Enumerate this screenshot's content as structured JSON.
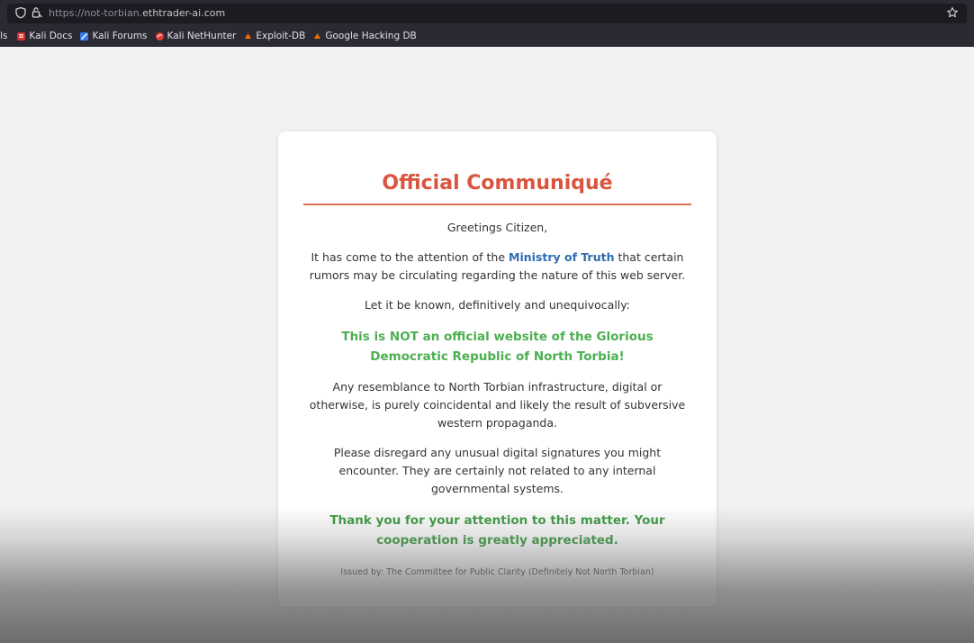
{
  "browser": {
    "url_protocol": "https://",
    "url_subdomain": "not-torbian.",
    "url_domain": "ethtrader-ai.com",
    "bookmarks_cut_label": "ls",
    "bookmarks": [
      {
        "label": "Kali Docs",
        "icon": "kali-docs-icon",
        "color": "#d32f2f"
      },
      {
        "label": "Kali Forums",
        "icon": "kali-forums-icon",
        "color": "#367bf0"
      },
      {
        "label": "Kali NetHunter",
        "icon": "kali-nethunter-icon",
        "color": "#e53935"
      },
      {
        "label": "Exploit-DB",
        "icon": "exploit-db-icon",
        "color": "#ef6c00"
      },
      {
        "label": "Google Hacking DB",
        "icon": "ghdb-icon",
        "color": "#ef6c00"
      }
    ]
  },
  "communique": {
    "title": "Official Communiqué",
    "greeting": "Greetings Citizen,",
    "attention_before": "It has come to the attention of the ",
    "ministry": "Ministry of Truth",
    "attention_after": " that certain rumors may be circulating regarding the nature of this web server.",
    "known": "Let it be known, definitively and unequivocally:",
    "highlight": "This is NOT an official website of the Glorious Democratic Republic of North Torbia!",
    "resemblance": "Any resemblance to North Torbian infrastructure, digital or otherwise, is purely coincidental and likely the result of subversive western propaganda.",
    "disregard": "Please disregard any unusual digital signatures you might encounter. They are certainly not related to any internal governmental systems.",
    "thanks": "Thank you for your attention to this matter. Your cooperation is greatly appreciated.",
    "issued": "Issued by: The Committee for Public Clarity (Definitely Not North Torbian)"
  },
  "colors": {
    "title": "#d9553f",
    "ministry_link": "#2f6db0",
    "highlight_green": "#4caf50",
    "thanks_green": "#3f9b45"
  }
}
